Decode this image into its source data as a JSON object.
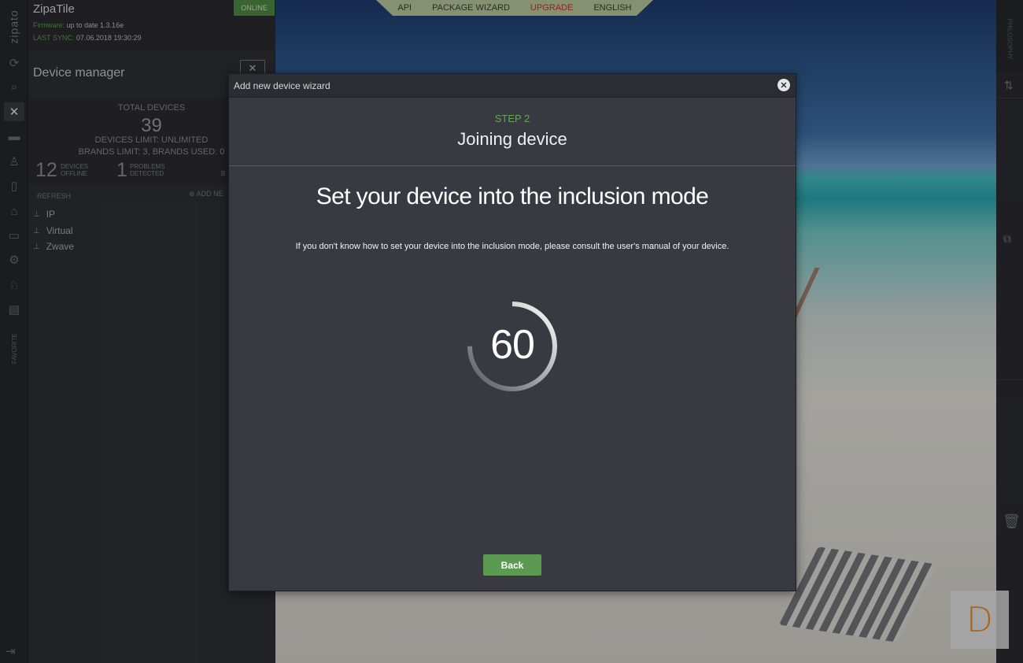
{
  "app": {
    "brand": "zipato",
    "box_name": "ZipaTile",
    "status": "ONLINE",
    "firmware_label": "Firmware:",
    "firmware_value": "up to date 1.3.16e",
    "last_sync_label": "LAST SYNC:",
    "last_sync_value": "07.06.2018 19:30:29"
  },
  "left_rail": {
    "icons": [
      "sync-icon",
      "search-icon",
      "devices-icon",
      "scenes-icon",
      "users-icon",
      "rules-icon",
      "security-icon",
      "folder-icon",
      "settings-icon",
      "awards-icon",
      "clipboard-icon"
    ],
    "active": "devices-icon",
    "favorite_label": "FAVORITE",
    "logout_icon": "logout-icon"
  },
  "device_manager": {
    "title": "Device manager",
    "total_label": "TOTAL DEVICES",
    "total_count": "39",
    "devices_limit": "DEVICES LIMIT: UNLIMITED",
    "brands_limit": "BRANDS LIMIT: 3, BRANDS USED: 0",
    "offline_count": "12",
    "offline_label_1": "DEVICES",
    "offline_label_2": "OFFLINE",
    "problems_count": "1",
    "problems_label_1": "PROBLEMS",
    "problems_label_2": "DETECTED",
    "cut_label": "B",
    "refresh_label": "REFRESH",
    "add_new_label": "ADD NE",
    "tree": [
      "IP",
      "Virtual",
      "Zwave"
    ]
  },
  "top_nav": {
    "items": [
      "API",
      "PACKAGE WIZARD",
      "UPGRADE",
      "ENGLISH"
    ]
  },
  "right_rail": {
    "vertical_label": "PHILOSOPHY",
    "icons": [
      "swap-icon",
      "external-link-icon",
      "trash-icon"
    ]
  },
  "watermark": {
    "letter": "D"
  },
  "wizard": {
    "title": "Add new device wizard",
    "step_label": "STEP 2",
    "step_title": "Joining device",
    "headline": "Set your device into the inclusion mode",
    "hint": "If you don't know how to set your device into the inclusion mode, please consult the user's manual of your device.",
    "countdown": "60",
    "countdown_progress": 0.75,
    "back_label": "Back"
  },
  "colors": {
    "accent_green": "#5b9a50",
    "step_green": "#63a852",
    "upgrade_red": "#c0392b",
    "watermark_orange": "#f08a24"
  }
}
